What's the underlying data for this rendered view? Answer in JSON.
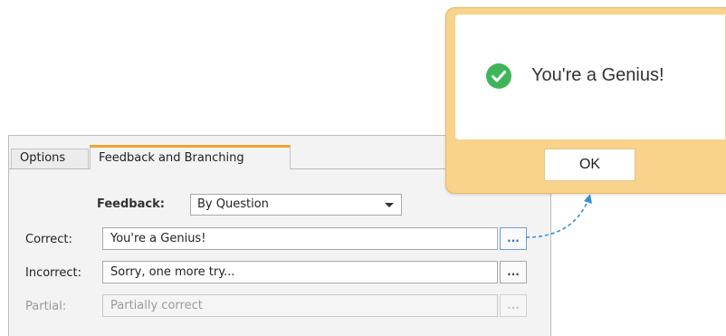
{
  "tabs": {
    "options_label": "Options",
    "feedback_label": "Feedback and Branching"
  },
  "feedback": {
    "label": "Feedback:",
    "selected_value": "By Question"
  },
  "fields": {
    "correct": {
      "label": "Correct:",
      "value": "You're a Genius!",
      "button": "..."
    },
    "incorrect": {
      "label": "Incorrect:",
      "value": "Sorry, one more try...",
      "button": "..."
    },
    "partial": {
      "label": "Partial:",
      "value": "Partially correct",
      "button": "...",
      "disabled": true
    }
  },
  "popup": {
    "message": "You're a Genius!",
    "ok_label": "OK",
    "icon": "check-circle-icon"
  },
  "colors": {
    "tab_accent": "#f0a42d",
    "popup_frame": "#f9d28b",
    "check_green": "#3fb55a",
    "arrow": "#3a8fd8"
  }
}
